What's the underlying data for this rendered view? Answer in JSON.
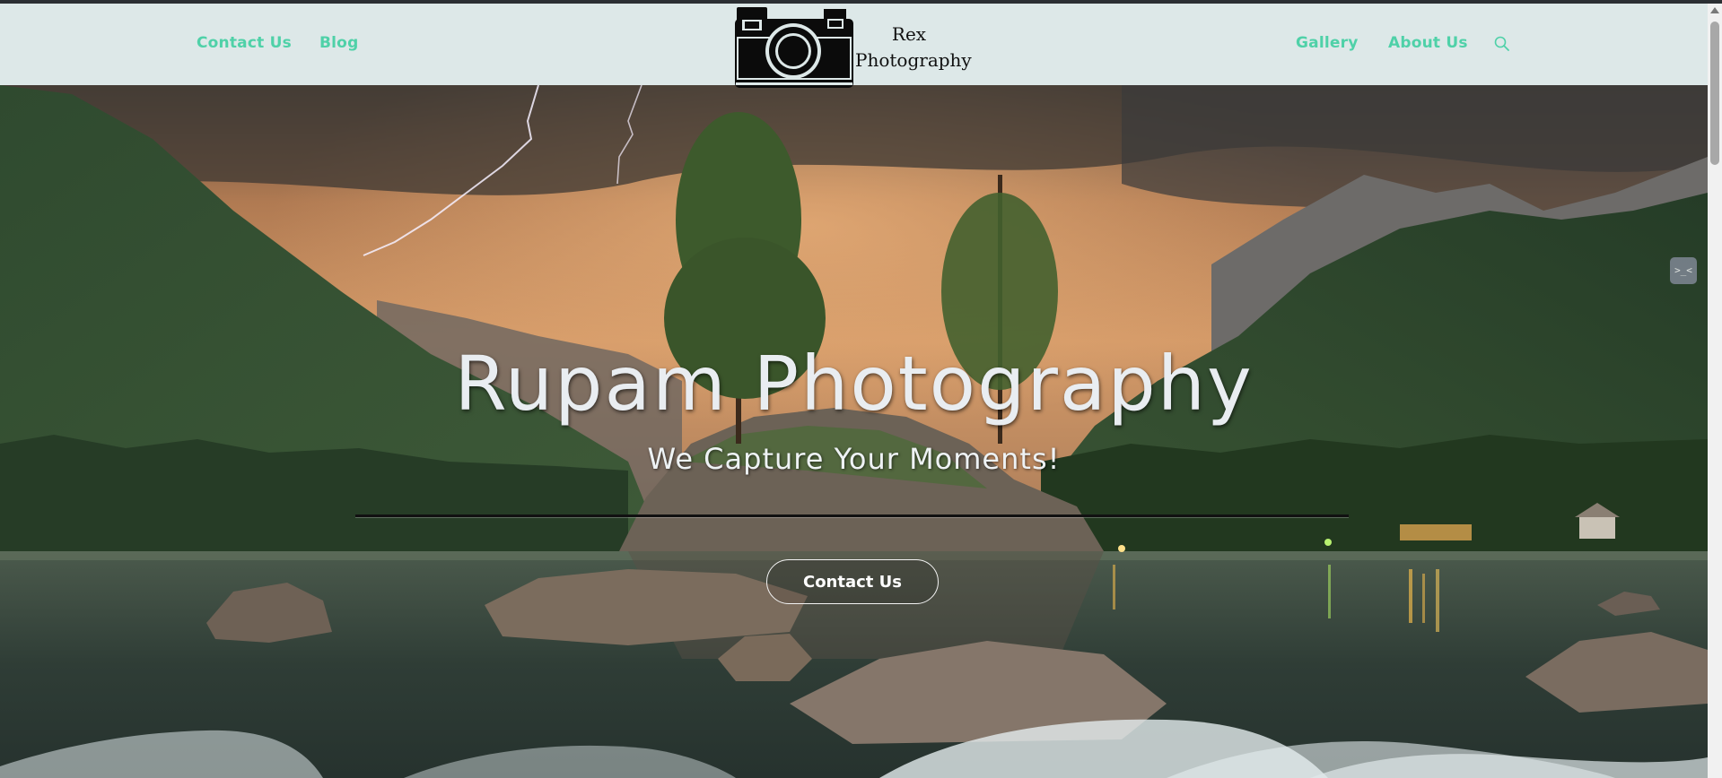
{
  "navbar": {
    "left_links": [
      "Contact Us",
      "Blog"
    ],
    "right_links": [
      "Gallery",
      "About Us"
    ],
    "search_icon": "search-icon",
    "link_color": "#4fd1a8",
    "background": "#dde8e8"
  },
  "logo": {
    "icon": "camera-icon",
    "line1": "Rex",
    "line2": "Photography"
  },
  "hero": {
    "title": "Rupam Photography",
    "subtitle": "We Capture Your Moments!",
    "cta_label": "Contact Us"
  },
  "side_widget": {
    "icon": "widget-face-icon",
    "label": ">_<"
  }
}
